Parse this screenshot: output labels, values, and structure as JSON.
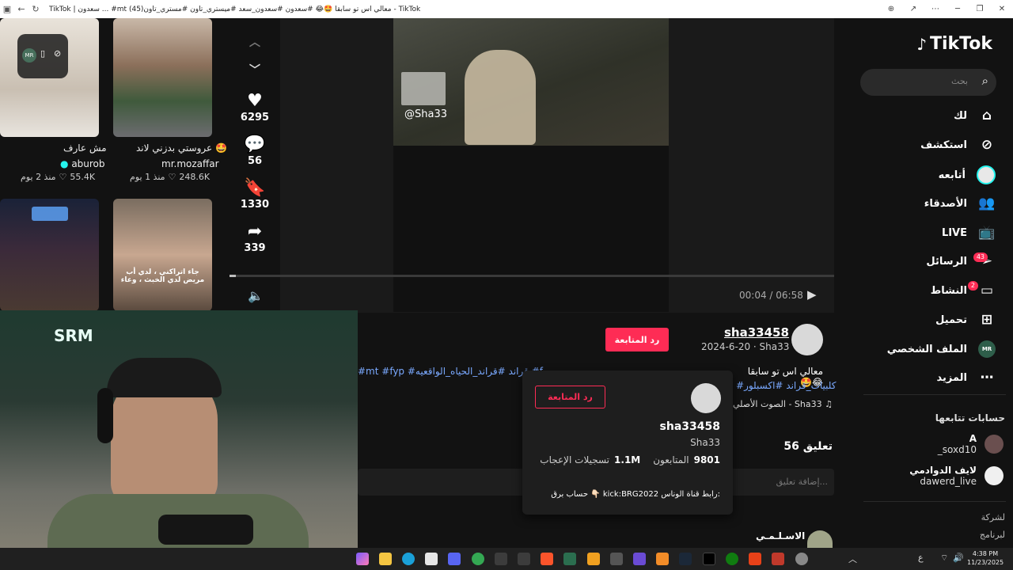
{
  "browser": {
    "title": "TikTok | سعدون ... #mt معالي اس تو سابقا 🤩😂 #سعدون #سعدون_سعد #ميستري_تاون #مستري_تاون(45) - TikTok",
    "back_icon": "arrow-left-icon",
    "refresh_icon": "refresh-icon"
  },
  "left_grid": [
    {
      "caption": "مش عارف",
      "author": "aburob",
      "views": "55.4K",
      "age": "منذ 2 يوم"
    },
    {
      "caption": "عروستي بدزني لاند 🤩",
      "author": "mr.mozaffar",
      "views": "248.6K",
      "age": "منذ 1 يوم"
    },
    {
      "caption": "",
      "author": "",
      "views": "",
      "age": ""
    },
    {
      "caption": "جاء اتراكني ، لدي أب مريض لدي الخبث ، وعاء",
      "author": "",
      "views": "",
      "age": ""
    }
  ],
  "actions": {
    "likes": "6295",
    "comments": "56",
    "saves": "1330",
    "shares": "339"
  },
  "video": {
    "watermark": "@Sha33",
    "time": "00:04 / 06:58",
    "progress": 0.01
  },
  "post": {
    "username": "sha33458",
    "date_line": "2024-6-20 · Sha33",
    "follow_back": "رد المتابعة",
    "caption": "معالي اس تو سابقا 🤩😂",
    "hashtags_line1": "#mt #fyp #قراند #قراند_الحياه_الواقعيه #f",
    "hashtags_line2": "#كلبيات_قراند #اكسبلور",
    "sound": "الصوت الأصلي - Sha33",
    "comments_count": "56 تعليق",
    "add_comment_placeholder": "إضافة تعليق...",
    "first_commenter": "الاسـلـمـي"
  },
  "popup": {
    "username": "sha33458",
    "nickname": "Sha33",
    "followers_value": "9801",
    "followers_label": "المتابعون",
    "likes_value": "1.1M",
    "likes_label": "تسجيلات الإعجاب",
    "follow_back": "رد المتابعة",
    "bio": "حساب برق 👇🏻 kick:BRG2022 رابط قناة الوناس:"
  },
  "sidebar": {
    "logo": "TikTok",
    "search_placeholder": "بحث",
    "items": [
      {
        "label": "لك",
        "icon": "home-icon"
      },
      {
        "label": "استكشف",
        "icon": "compass-icon"
      },
      {
        "label": "أتابعه",
        "icon": "following-avatar-icon"
      },
      {
        "label": "الأصدقاء",
        "icon": "friends-icon"
      },
      {
        "label": "LIVE",
        "icon": "live-icon"
      },
      {
        "label": "الرسائل",
        "icon": "messages-icon",
        "badge": "43"
      },
      {
        "label": "النشاط",
        "icon": "activity-icon",
        "badge": "2"
      },
      {
        "label": "تحميل",
        "icon": "upload-icon"
      },
      {
        "label": "الملف الشخصي",
        "icon": "profile-icon"
      },
      {
        "label": "المزيد",
        "icon": "more-icon"
      }
    ],
    "following_header": "حسابات تتابعها",
    "following": [
      {
        "name": "A",
        "handle": "_soxd10"
      },
      {
        "name": "لايف الدوادمي",
        "handle": "dawerd_live"
      }
    ],
    "footer1": "لشركة",
    "footer2": "لبرنامج"
  },
  "taskbar": {
    "time": "4:38 PM",
    "date": "11/23/2025"
  }
}
